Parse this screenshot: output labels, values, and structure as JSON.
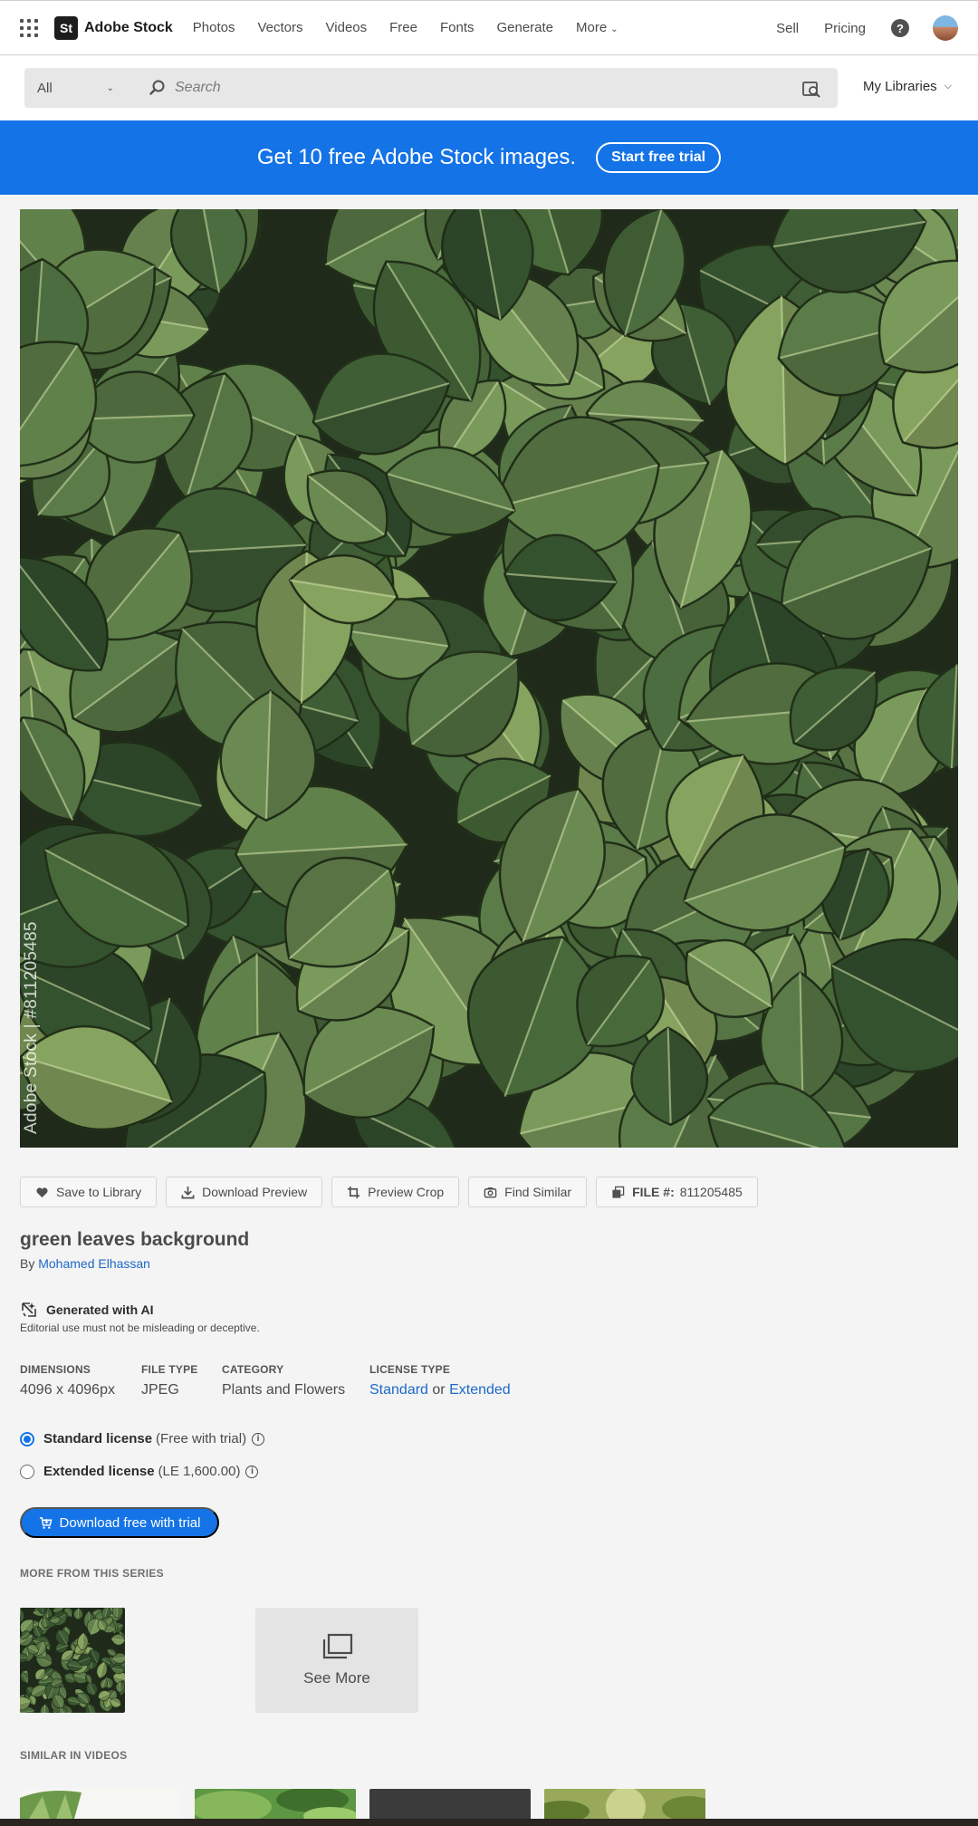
{
  "brand": {
    "logo_text": "St",
    "name": "Adobe Stock"
  },
  "nav": {
    "links": [
      "Photos",
      "Vectors",
      "Videos",
      "Free",
      "Fonts",
      "Generate"
    ],
    "more_label": "More",
    "sell_label": "Sell",
    "pricing_label": "Pricing",
    "help_glyph": "?"
  },
  "search": {
    "scope_value": "All",
    "placeholder": "Search",
    "libraries_label": "My Libraries"
  },
  "banner": {
    "text": "Get 10 free Adobe Stock images.",
    "cta_label": "Start free trial",
    "color": "#1473e6"
  },
  "image": {
    "watermark": "Adobe Stock | #811205485"
  },
  "actions": {
    "save_label": "Save to Library",
    "download_preview_label": "Download Preview",
    "preview_crop_label": "Preview Crop",
    "find_similar_label": "Find Similar",
    "file_label": "FILE #:",
    "file_number": "811205485"
  },
  "asset": {
    "title": "green leaves background",
    "by_label": "By",
    "author": "Mohamed Elhassan",
    "ai_title": "Generated with AI",
    "ai_note": "Editorial use must not be misleading or deceptive."
  },
  "details": {
    "dimensions_label": "DIMENSIONS",
    "dimensions_value": "4096 x 4096px",
    "file_type_label": "FILE TYPE",
    "file_type_value": "JPEG",
    "category_label": "CATEGORY",
    "category_value": "Plants and Flowers",
    "license_type_label": "LICENSE TYPE",
    "license_standard": "Standard",
    "license_or": "or",
    "license_extended": "Extended"
  },
  "licenses": {
    "standard_name": "Standard license",
    "standard_price": "(Free with trial)",
    "extended_name": "Extended license",
    "extended_price": "(LE 1,600.00)",
    "selected": "standard"
  },
  "download": {
    "label": "Download free with trial"
  },
  "series": {
    "heading": "MORE FROM THIS SERIES",
    "see_more_label": "See More"
  },
  "similar_videos": {
    "heading": "SIMILAR IN VIDEOS"
  },
  "icons": {
    "apps": "apps-grid-icon",
    "help": "help-icon",
    "search": "search-icon",
    "visual_search": "visual-search-icon",
    "heart": "heart-icon",
    "download": "download-icon",
    "crop": "crop-icon",
    "camera": "camera-icon",
    "file": "file-icon",
    "ai": "ai-generated-icon",
    "info": "info-icon",
    "cart": "cart-icon",
    "stack": "stack-icon"
  }
}
